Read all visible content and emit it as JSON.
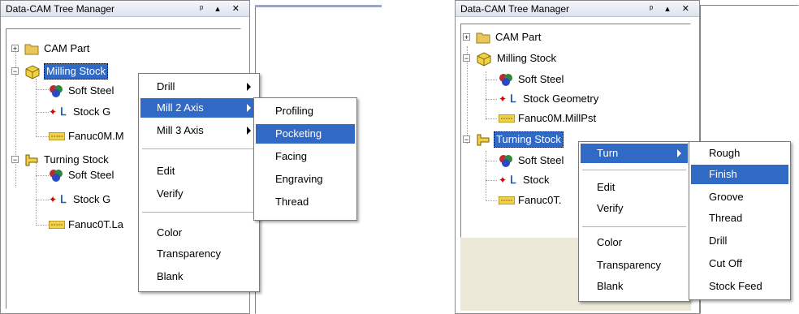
{
  "left": {
    "title": "Data-CAM Tree Manager",
    "pin_glyph": "ᵖ",
    "ctrl_glyphs": "▴ ✕",
    "tree": [
      {
        "label": "CAM Part",
        "icon": "folder-icon"
      },
      {
        "label": "Milling Stock",
        "icon": "milling-stock-icon"
      },
      {
        "label": "Soft Steel",
        "icon": "material-icon"
      },
      {
        "label": "Stock G",
        "icon": "stock-geometry-icon"
      },
      {
        "label": "Fanuc0M.M",
        "icon": "post-icon"
      },
      {
        "label": "Turning Stock",
        "icon": "turning-stock-icon"
      },
      {
        "label": "Soft Steel",
        "icon": "material-icon"
      },
      {
        "label": "Stock G",
        "icon": "stock-geometry-icon"
      },
      {
        "label": "Fanuc0T.La",
        "icon": "post-icon"
      }
    ],
    "context_menu": [
      "Drill",
      "Mill 2 Axis",
      "Mill 3 Axis",
      "Edit",
      "Verify",
      "Color",
      "Transparency",
      "Blank"
    ],
    "submenu": [
      "Profiling",
      "Pocketing",
      "Facing",
      "Engraving",
      "Thread"
    ]
  },
  "right": {
    "title": "Data-CAM Tree Manager",
    "pin_glyph": "ᵖ",
    "ctrl_glyphs": "▴ ✕",
    "tree": [
      {
        "label": "CAM Part",
        "icon": "folder-icon"
      },
      {
        "label": "Milling Stock",
        "icon": "milling-stock-icon"
      },
      {
        "label": "Soft Steel",
        "icon": "material-icon"
      },
      {
        "label": "Stock Geometry",
        "icon": "stock-geometry-icon"
      },
      {
        "label": "Fanuc0M.MillPst",
        "icon": "post-icon"
      },
      {
        "label": "Turning Stock",
        "icon": "turning-stock-icon"
      },
      {
        "label": "Soft Steel",
        "icon": "material-icon"
      },
      {
        "label": "Stock",
        "icon": "stock-geometry-icon"
      },
      {
        "label": "Fanuc0T.",
        "icon": "post-icon"
      }
    ],
    "context_menu": [
      "Turn",
      "Edit",
      "Verify",
      "Color",
      "Transparency",
      "Blank"
    ],
    "submenu": [
      "Rough",
      "Finish",
      "Groove",
      "Thread",
      "Drill",
      "Cut Off",
      "Stock Feed"
    ]
  }
}
